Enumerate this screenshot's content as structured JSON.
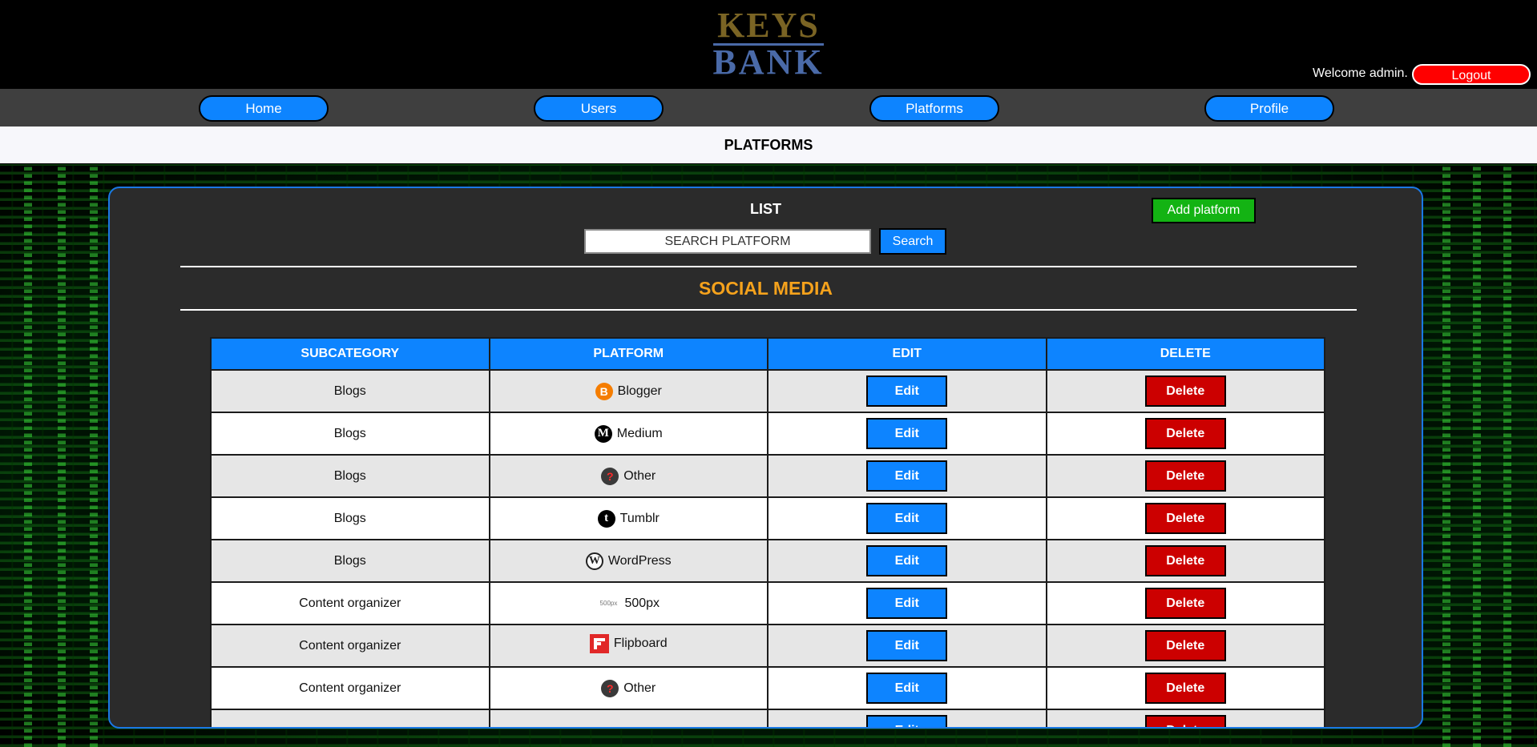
{
  "logo": {
    "line1": "KEYS",
    "line2": "BANK"
  },
  "header": {
    "welcome_text": "Welcome admin.",
    "logout_label": "Logout"
  },
  "nav": {
    "items": [
      {
        "label": "Home"
      },
      {
        "label": "Users"
      },
      {
        "label": "Platforms"
      },
      {
        "label": "Profile"
      }
    ]
  },
  "page_title": "PLATFORMS",
  "panel": {
    "list_title": "LIST",
    "add_button_label": "Add platform",
    "search": {
      "value": "SEARCH PLATFORM",
      "button_label": "Search"
    },
    "section_title": "SOCIAL MEDIA"
  },
  "table": {
    "headers": [
      "SUBCATEGORY",
      "PLATFORM",
      "EDIT",
      "DELETE"
    ],
    "edit_label": "Edit",
    "delete_label": "Delete",
    "rows": [
      {
        "subcategory": "Blogs",
        "platform": "Blogger",
        "icon": "blogger-icon",
        "glyph": "B"
      },
      {
        "subcategory": "Blogs",
        "platform": "Medium",
        "icon": "medium-icon",
        "glyph": "M"
      },
      {
        "subcategory": "Blogs",
        "platform": "Other",
        "icon": "question-icon",
        "glyph": "?"
      },
      {
        "subcategory": "Blogs",
        "platform": "Tumblr",
        "icon": "tumblr-icon",
        "glyph": "t"
      },
      {
        "subcategory": "Blogs",
        "platform": "WordPress",
        "icon": "wordpress-icon",
        "glyph": "W"
      },
      {
        "subcategory": "Content organizer",
        "platform": "500px",
        "icon": "500px-icon",
        "glyph": "500px"
      },
      {
        "subcategory": "Content organizer",
        "platform": "Flipboard",
        "icon": "flipboard-icon",
        "glyph": ""
      },
      {
        "subcategory": "Content organizer",
        "platform": "Other",
        "icon": "question-icon",
        "glyph": "?"
      }
    ]
  },
  "colors": {
    "primary_blue": "#0d84ff",
    "logout_red": "#ff0000",
    "delete_red": "#cc0000",
    "add_green": "#13b313",
    "section_orange": "#f5a21c"
  }
}
